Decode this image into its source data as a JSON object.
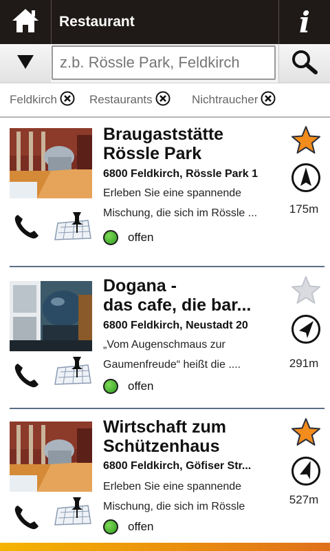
{
  "header": {
    "title": "Restaurant",
    "info_label": "i"
  },
  "search": {
    "placeholder": "z.b. Rössle Park, Feldkirch"
  },
  "filters": [
    {
      "label": "Feldkirch"
    },
    {
      "label": "Restaurants"
    },
    {
      "label": "Nichtraucher"
    }
  ],
  "items": [
    {
      "name": "Braugaststätte\nRössle Park",
      "address": "6800 Feldkirch, Rössle Park 1",
      "description": "Erleben Sie eine spannende\nMischung, die sich im Rössle ...",
      "status": "offen",
      "favorite": true,
      "distance": "175m"
    },
    {
      "name": "Dogana -\ndas cafe, die bar...",
      "address": "6800 Feldkirch, Neustadt 20",
      "description": "„Vom Augenschmaus zur\nGaumenfreude“ heißt die ....",
      "status": "offen",
      "favorite": false,
      "distance": "291m"
    },
    {
      "name": "Wirtschaft zum\nSchützenhaus",
      "address": "6800 Feldkirch, Göfiser Str...",
      "description": "Erleben Sie eine spannende\nMischung, die sich im Rössle",
      "status": "offen",
      "favorite": true,
      "distance": "527m"
    }
  ],
  "colors": {
    "header_bg": "#1f1a17",
    "star_active": "#f28c1c",
    "star_inactive": "#d9dbe0",
    "status_open": "#3aa62a",
    "divider": "#5b6e86",
    "accent_bar": "#f5b400"
  }
}
